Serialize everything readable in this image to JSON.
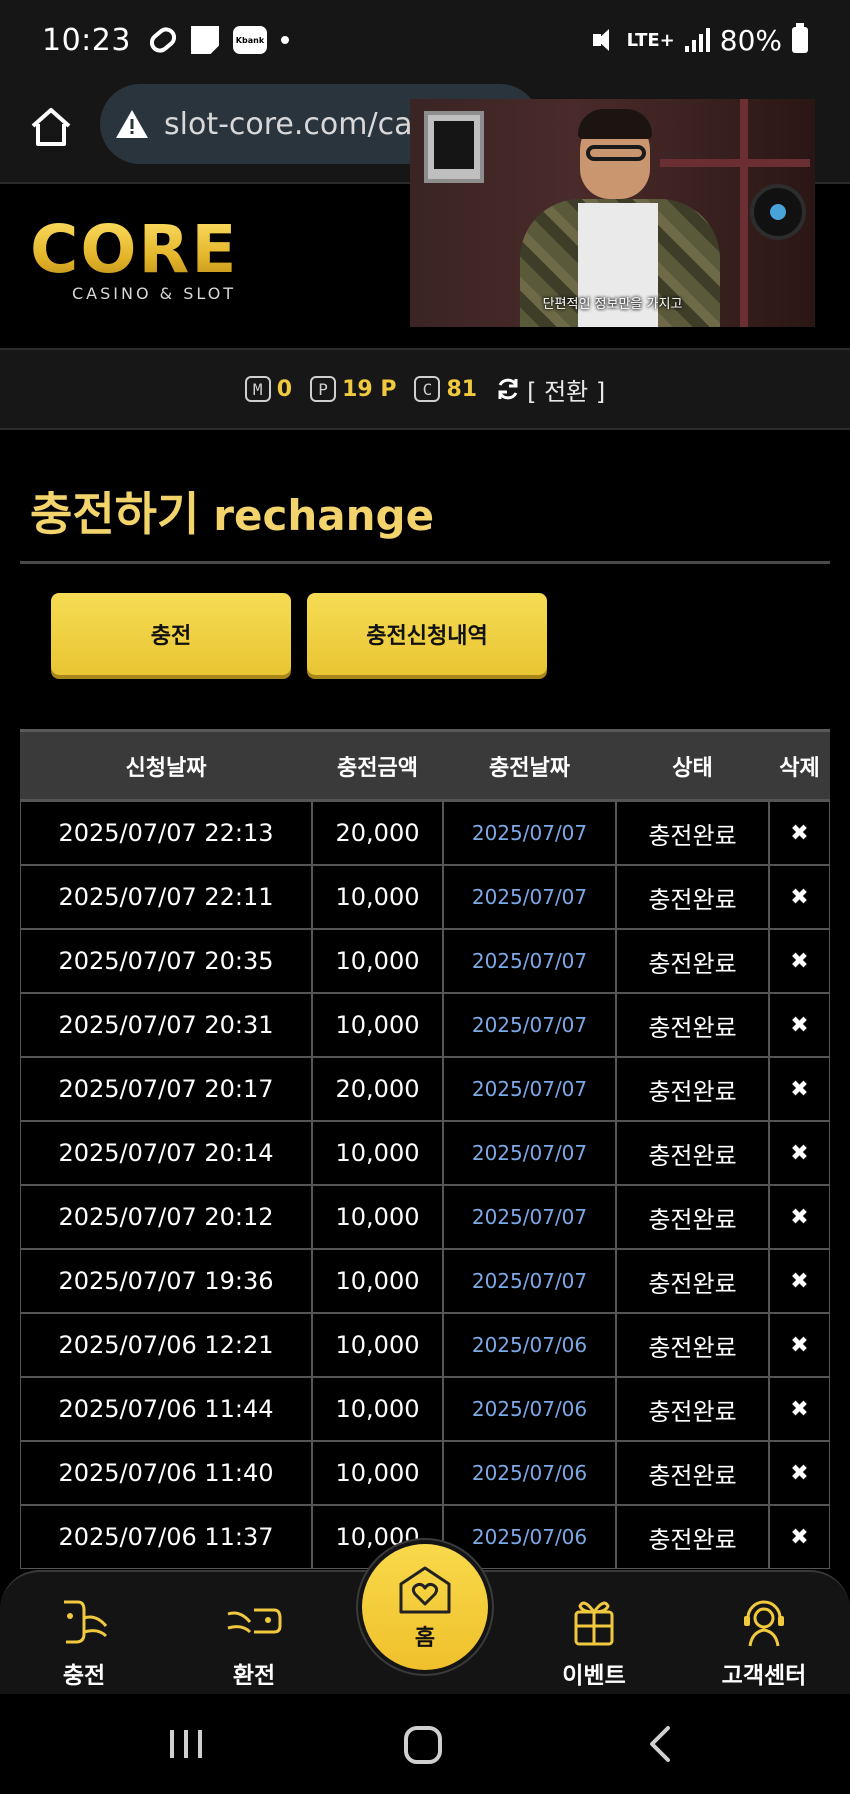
{
  "status_bar": {
    "time": "10:23",
    "kbank_label": "Kbank",
    "network": "LTE+",
    "battery": "80%"
  },
  "browser": {
    "url": "slot-core.com/ca"
  },
  "video_overlay": {
    "caption": "단편적인 정보만을 가지고"
  },
  "logo": {
    "main": "CORE",
    "sub": "CASINO & SLOT"
  },
  "points": {
    "m_label": "M",
    "m_value": "0",
    "p_label": "P",
    "p_value": "19 P",
    "c_label": "C",
    "c_value": "81",
    "convert_label": "[ 전환 ]"
  },
  "page": {
    "title_ko": "충전하기",
    "title_en": "rechange"
  },
  "buttons": {
    "charge": "충전",
    "history": "충전신청내역"
  },
  "table": {
    "headers": [
      "신청날짜",
      "충전금액",
      "충전날짜",
      "상태",
      "삭제"
    ],
    "rows": [
      {
        "requested": "2025/07/07 22:13",
        "amount": "20,000",
        "charged": "2025/07/07",
        "status": "충전완료",
        "delete": "✖"
      },
      {
        "requested": "2025/07/07 22:11",
        "amount": "10,000",
        "charged": "2025/07/07",
        "status": "충전완료",
        "delete": "✖"
      },
      {
        "requested": "2025/07/07 20:35",
        "amount": "10,000",
        "charged": "2025/07/07",
        "status": "충전완료",
        "delete": "✖"
      },
      {
        "requested": "2025/07/07 20:31",
        "amount": "10,000",
        "charged": "2025/07/07",
        "status": "충전완료",
        "delete": "✖"
      },
      {
        "requested": "2025/07/07 20:17",
        "amount": "20,000",
        "charged": "2025/07/07",
        "status": "충전완료",
        "delete": "✖"
      },
      {
        "requested": "2025/07/07 20:14",
        "amount": "10,000",
        "charged": "2025/07/07",
        "status": "충전완료",
        "delete": "✖"
      },
      {
        "requested": "2025/07/07 20:12",
        "amount": "10,000",
        "charged": "2025/07/07",
        "status": "충전완료",
        "delete": "✖"
      },
      {
        "requested": "2025/07/07 19:36",
        "amount": "10,000",
        "charged": "2025/07/07",
        "status": "충전완료",
        "delete": "✖"
      },
      {
        "requested": "2025/07/06 12:21",
        "amount": "10,000",
        "charged": "2025/07/06",
        "status": "충전완료",
        "delete": "✖"
      },
      {
        "requested": "2025/07/06 11:44",
        "amount": "10,000",
        "charged": "2025/07/06",
        "status": "충전완료",
        "delete": "✖"
      },
      {
        "requested": "2025/07/06 11:40",
        "amount": "10,000",
        "charged": "2025/07/06",
        "status": "충전완료",
        "delete": "✖"
      },
      {
        "requested": "2025/07/06 11:37",
        "amount": "10,000",
        "charged": "2025/07/06",
        "status": "충전완료",
        "delete": "✖"
      }
    ]
  },
  "bottom_nav": {
    "items": [
      {
        "label": "충전",
        "icon": "deposit-icon"
      },
      {
        "label": "환전",
        "icon": "withdraw-icon"
      },
      {
        "label": "홈",
        "icon": "home-heart-icon"
      },
      {
        "label": "이벤트",
        "icon": "gift-icon"
      },
      {
        "label": "고객센터",
        "icon": "support-icon"
      }
    ]
  },
  "colors": {
    "accent": "#f0c93f",
    "button": "#efcf3d",
    "link_date": "#7da8e6"
  }
}
